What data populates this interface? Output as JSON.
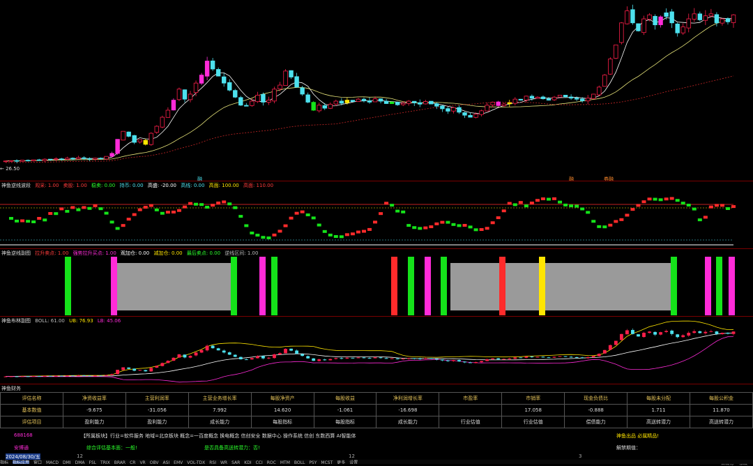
{
  "colors": {
    "up": "#ff1f4a",
    "down": "#4de1ee",
    "magenta": "#ff2bd8",
    "green": "#15e31a",
    "yellow": "#ffe500",
    "ma": "#e8e57a",
    "red": "#ff2b2b",
    "gray": "#9a9a9a"
  },
  "main": {
    "low_label": "← 26.50"
  },
  "markers": [
    {
      "text": "融"
    },
    {
      "text": "融"
    },
    {
      "text": "券融"
    }
  ],
  "pane2": {
    "title": "神鱼逆线波段",
    "items": [
      {
        "text": "观采: 1.00",
        "color": "#ff3b3b"
      },
      {
        "text": "卖股: 1.00",
        "color": "#ff3b3b"
      },
      {
        "text": "稳卖: 0.00",
        "color": "#2bff2b"
      },
      {
        "text": "持币: 0.00",
        "color": "#4de1ee"
      },
      {
        "text": "高盛: -20.00",
        "color": "#ffffff"
      },
      {
        "text": "高线: 0.00",
        "color": "#4de1ee"
      },
      {
        "text": "高面: 100.00",
        "color": "#ffe500"
      },
      {
        "text": "高面: 110.00",
        "color": "#ff3b3b"
      }
    ]
  },
  "pane3": {
    "title": "神鱼逆线副图",
    "items": [
      {
        "text": "拉升卖点: 1.00",
        "color": "#ff3b3b"
      },
      {
        "text": "强势拉升买点: 1.00",
        "color": "#ff2bd8"
      },
      {
        "text": "观加仓: 0.00",
        "color": "#ffffff"
      },
      {
        "text": "减加仓: 0.00",
        "color": "#ffe500"
      },
      {
        "text": "最后卖点: 0.00",
        "color": "#2bff2b"
      },
      {
        "text": "逆线区间: 1.00",
        "color": "#bbbbbb"
      }
    ]
  },
  "pane4": {
    "title": "神鱼布林副图",
    "items": [
      {
        "text": "BOLL: 61.00",
        "color": "#bbbbbb"
      },
      {
        "text": "UB: 76.93",
        "color": "#ffe500"
      },
      {
        "text": "LB: 45.06",
        "color": "#ff2bd8"
      }
    ]
  },
  "finance": {
    "title": "神鱼财务",
    "headers": [
      "评估名称",
      "净资收益率",
      "主营利润率",
      "主营业务增长率",
      "每股净资产",
      "每股收益",
      "净利润增长率",
      "市盈率",
      "市销率",
      "现金负债比",
      "每股未分配",
      "每股公积金"
    ],
    "values": [
      "基本数值",
      "-9.675",
      "-31.056",
      "7.992",
      "14.620",
      "-1.061",
      "-16.698",
      "",
      "17.058",
      "-0.888",
      "1.711",
      "11.870"
    ],
    "factors": [
      "评估项目",
      "盈利能力",
      "盈利能力",
      "成长能力",
      "每股指标",
      "每股指标",
      "成长能力",
      "行业估值",
      "行业估值",
      "偿债能力",
      "高送转潜力",
      "高送转潜力"
    ]
  },
  "info": {
    "code": "688168",
    "name": "安博通",
    "news": "【所属板块】行业=软件服务 地域=北京板块 概念=一百度概念 换电概念 信创安全 数据中心 操作系统 信创 东数西算 AI智能体",
    "promo": "神鱼出品 必属精品!",
    "rating": "综合评估基本面：一般!",
    "dividend": "是否具备高送转潜力：否!",
    "unlock": "解禁期值："
  },
  "bottom": {
    "date": "2024/08/30/五",
    "axis": [
      "12",
      "",
      "12",
      "",
      "",
      "3",
      ""
    ],
    "right": [
      "自线化",
      "修改"
    ],
    "tabs": [
      "指标",
      "指标应用",
      "窗口",
      "MACD",
      "DMI",
      "DMA",
      "FSL",
      "TRIX",
      "BRAR",
      "CR",
      "VR",
      "OBV",
      "ASI",
      "EMV",
      "VOL-TDX",
      "RSI",
      "WR",
      "SAR",
      "KDJ",
      "CCI",
      "ROC",
      "MTM",
      "BOLL",
      "PSY",
      "MCST",
      "更多",
      "设置"
    ]
  },
  "chart_data": {
    "type": "candlestick",
    "title": "",
    "note": "Daily K-line with MA lines; subplots: wave oscillator, signal bars, BOLL",
    "closes": [
      27.2,
      27.4,
      27.1,
      27.6,
      27.3,
      27.8,
      27.5,
      28.1,
      27.9,
      28.3,
      28.0,
      28.6,
      28.2,
      28.9,
      28.4,
      28.1,
      28.6,
      28.3,
      29.5,
      31.0,
      38.0,
      42.0,
      39.5,
      36.5,
      37.8,
      35.5,
      41.0,
      44.5,
      49.0,
      52.5,
      57.5,
      63.0,
      58.0,
      60.5,
      66.0,
      70.0,
      77.0,
      73.0,
      69.5,
      66.0,
      62.5,
      59.0,
      55.0,
      54.5,
      57.0,
      60.0,
      56.5,
      57.5,
      63.0,
      65.0,
      72.0,
      69.0,
      64.0,
      60.5,
      56.5,
      52.5,
      55.0,
      53.5,
      55.5,
      57.0,
      56.0,
      57.5,
      56.8,
      58.0,
      57.2,
      56.5,
      58.2,
      57.0,
      55.8,
      56.6,
      55.2,
      56.0,
      57.0,
      56.2,
      55.5,
      56.8,
      55.6,
      54.5,
      53.2,
      52.0,
      53.8,
      51.5,
      50.0,
      49.0,
      50.5,
      52.2,
      55.0,
      56.5,
      54.8,
      55.6,
      56.2,
      58.0,
      57.5,
      59.5,
      58.5,
      59.0,
      58.2,
      57.5,
      59.0,
      60.0,
      59.2,
      58.5,
      58.0,
      57.2,
      58.5,
      60.5,
      64.0,
      70.0,
      78.0,
      85.0,
      96.0,
      102.0,
      96.0,
      92.0,
      98.0,
      100.0,
      95.0,
      99.0,
      101.0,
      96.0,
      91.0,
      94.0,
      98.0,
      100.5,
      97.5,
      99.5,
      100.5,
      96.0,
      98.0,
      96.5,
      100.0
    ],
    "series": [
      {
        "name": "BOLL",
        "last": 61.0
      },
      {
        "name": "UB",
        "last": 76.93
      },
      {
        "name": "LB",
        "last": 45.06
      }
    ]
  }
}
